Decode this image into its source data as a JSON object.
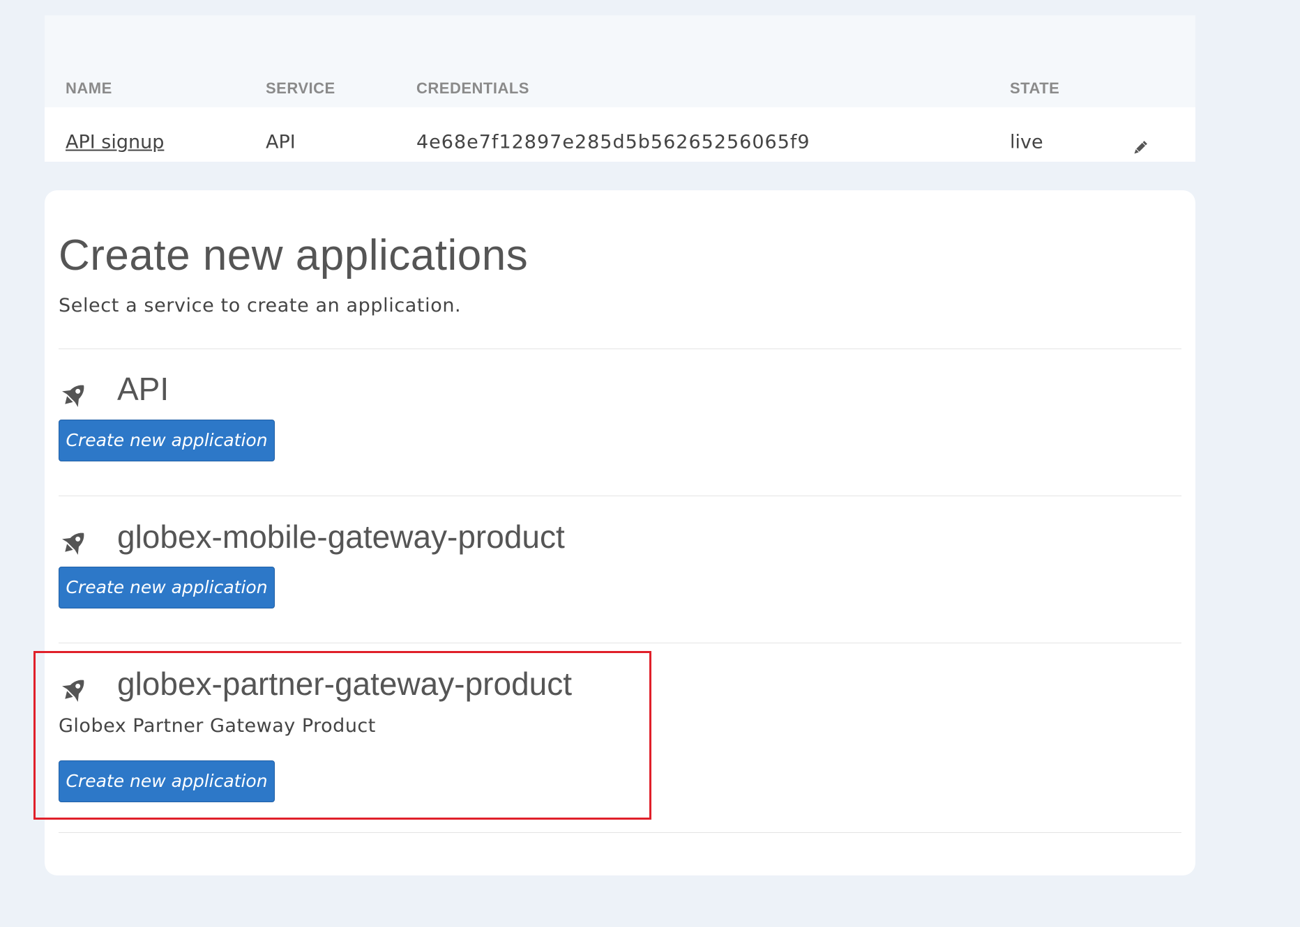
{
  "applications_table": {
    "columns": {
      "name": "NAME",
      "service": "SERVICE",
      "credentials": "CREDENTIALS",
      "state": "STATE"
    },
    "rows": [
      {
        "name": "API signup",
        "service": "API",
        "credentials": "4e68e7f12897e285d5b56265256065f9",
        "state": "live",
        "action_icon": "pencil-icon"
      }
    ]
  },
  "create_section": {
    "title": "Create new applications",
    "subtitle": "Select a service to create an application.",
    "services": [
      {
        "name": "API",
        "description": "",
        "icon": "rocket-icon",
        "button_label": "Create new application"
      },
      {
        "name": "globex-mobile-gateway-product",
        "description": "",
        "icon": "rocket-icon",
        "button_label": "Create new application"
      },
      {
        "name": "globex-partner-gateway-product",
        "description": "Globex Partner Gateway Product",
        "icon": "rocket-icon",
        "button_label": "Create new application",
        "highlighted": true
      }
    ]
  },
  "colors": {
    "page_background": "#edf2f8",
    "button_background": "#2d78c8",
    "highlight_border": "#e0202a",
    "text": "#555555"
  }
}
